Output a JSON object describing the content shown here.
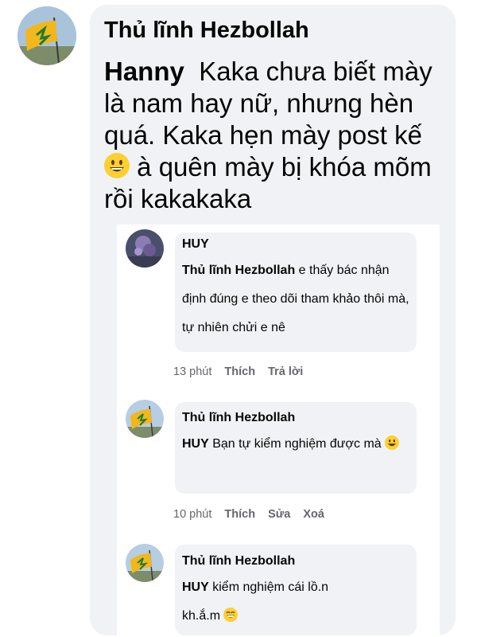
{
  "main_comment": {
    "author": "Thủ lĩnh Hezbollah",
    "tag": "Hanny",
    "text_part1": "Kaka chưa biết mày là nam hay nữ, nhưng hèn quá. Kaka hẹn mày post kế",
    "text_part2": "à quên mày bị khóa mõm rồi kakakaka",
    "emoji": "grinning-face"
  },
  "replies": [
    {
      "author": "HUY",
      "tag": "Thủ lĩnh Hezbollah",
      "text": "e thấy bác nhận định đúng e theo dõi tham khảo thôi mà, tự nhiên chửi e nê",
      "time": "13 phút",
      "actions": [
        "Thích",
        "Trả lời"
      ]
    },
    {
      "author": "Thủ lĩnh Hezbollah",
      "tag": "HUY",
      "text": "Bạn tự kiểm nghiệm được mà",
      "emoji": "grinning-face",
      "time": "10 phút",
      "actions": [
        "Thích",
        "Sửa",
        "Xoá"
      ]
    },
    {
      "author": "Thủ lĩnh Hezbollah",
      "tag": "HUY",
      "text": "kiểm nghiệm cái lồ.n kh.ắ.m",
      "emoji": "grinning-face-smiling-eyes"
    }
  ],
  "colors": {
    "bubble": "#f0f2f5",
    "meta_text": "#65676b",
    "flag_yellow": "#f2b71b",
    "flag_green": "#1e7a34"
  }
}
